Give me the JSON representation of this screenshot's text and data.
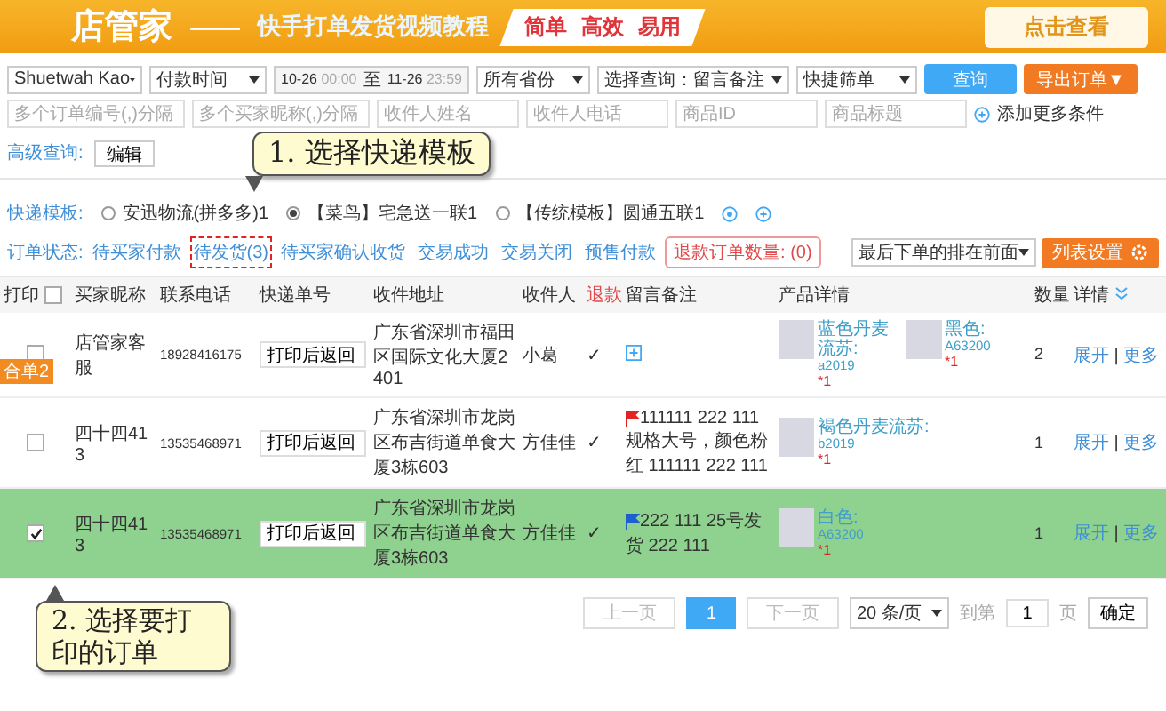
{
  "banner": {
    "logo": "店管家",
    "dash": "——",
    "title": "快手打单发货视频教程",
    "slogans": [
      "简单",
      "高效",
      "易用"
    ],
    "button": "点击查看"
  },
  "filters": {
    "shop": "Shuetwah Kao",
    "time_type": "付款时间",
    "date_range": {
      "start_date": "10-26",
      "start_time": "00:00",
      "separator": "至",
      "end_date": "11-26",
      "end_time": "23:59"
    },
    "province": "所有省份",
    "query_type": "选择查询：留言备注",
    "quick_filter": "快捷筛单",
    "search_button": "查询",
    "export_button": "导出订单▼"
  },
  "inputs": [
    {
      "placeholder": "多个订单编号(,)分隔"
    },
    {
      "placeholder": "多个买家昵称(,)分隔"
    },
    {
      "placeholder": "收件人姓名"
    },
    {
      "placeholder": "收件人电话"
    },
    {
      "placeholder": "商品ID"
    },
    {
      "placeholder": "商品标题"
    }
  ],
  "add_condition": "添加更多条件",
  "advanced": {
    "label": "高级查询:",
    "edit_button": "编辑"
  },
  "callouts": [
    "1. 选择快递模板",
    "2. 选择要打印的订单"
  ],
  "templates": {
    "label": "快递模板:",
    "options": [
      {
        "label": "安迅物流(拼多多)1",
        "selected": false
      },
      {
        "label": "【菜鸟】宅急送一联1",
        "selected": true
      },
      {
        "label": "【传统模板】圆通五联1",
        "selected": false
      }
    ]
  },
  "status": {
    "label": "订单状态:",
    "items": [
      {
        "label": "待买家付款",
        "selected": false
      },
      {
        "label": "待发货(3)",
        "selected": true
      },
      {
        "label": "待买家确认收货",
        "selected": false
      },
      {
        "label": "交易成功",
        "selected": false
      },
      {
        "label": "交易关闭",
        "selected": false
      },
      {
        "label": "预售付款",
        "selected": false
      }
    ],
    "refund": "退款订单数量: (0)",
    "sort": "最后下单的排在前面",
    "list_settings": "列表设置"
  },
  "table": {
    "columns": [
      "打印",
      "买家昵称",
      "联系电话",
      "快递单号",
      "收件地址",
      "收件人",
      "退款",
      "留言备注",
      "产品详情",
      "数量",
      "详情"
    ],
    "all_checked": false,
    "rows": [
      {
        "badge": "合单2",
        "checked": false,
        "selected": false,
        "buyer": "店管家客服",
        "phone": "18928416175",
        "tracking": "打印后返回",
        "address": "广东省深圳市福田区国际文化大厦2401",
        "receiver": "小葛",
        "mark": "✓",
        "note_icon": true,
        "products": [
          {
            "name": "蓝色丹麦流苏:",
            "code": "a2019",
            "qty": "*1"
          },
          {
            "name": "黑色:",
            "code": "A63200",
            "qty": "*1"
          }
        ],
        "count": "2",
        "expand": "展开",
        "separator": "|",
        "more": "更多"
      },
      {
        "checked": false,
        "selected": false,
        "buyer": "四十四413",
        "phone": "13535468971",
        "tracking": "打印后返回",
        "address": "广东省深圳市龙岗区布吉街道单食大厦3栋603",
        "receiver": "方佳佳",
        "mark": "✓",
        "note_icon": false,
        "color": "#e02424",
        "note": "111111 222 111 规格大号，颜色粉红 111111 222 111",
        "products": [
          {
            "name": "褐色丹麦流苏:",
            "code": "b2019",
            "qty": "*1"
          }
        ],
        "count": "1",
        "expand": "展开",
        "separator": "|",
        "more": "更多"
      },
      {
        "checked": true,
        "selected": true,
        "buyer": "四十四413",
        "phone": "13535468971",
        "tracking": "打印后返回",
        "address": "广东省深圳市龙岗区布吉街道单食大厦3栋603",
        "receiver": "方佳佳",
        "mark": "✓",
        "note_icon": false,
        "color": "#1e5fd0",
        "note": "222 111 25号发货 222 111",
        "products": [
          {
            "name": "白色:",
            "code": "A63200",
            "qty": "*1"
          }
        ],
        "count": "1",
        "expand": "展开",
        "separator": "|",
        "more": "更多"
      }
    ]
  },
  "pagination": {
    "prev": "上一页",
    "pages": [
      {
        "label": "1",
        "selected": true
      }
    ],
    "next": "下一页",
    "page_size": "20 条/页",
    "goto_label": "到第",
    "goto_value": "1",
    "page_unit": "页",
    "confirm": "确定"
  }
}
